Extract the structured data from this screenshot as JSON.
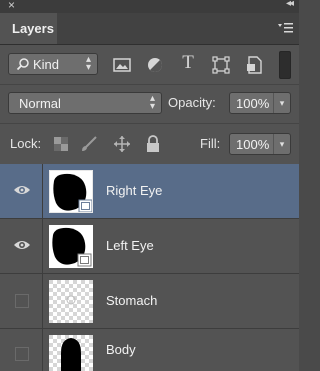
{
  "panel": {
    "close_glyph": "×",
    "collapse_glyph": "◂◂",
    "tab_label": "Layers"
  },
  "filter": {
    "kind_label": "Kind",
    "icons": [
      "pixel-filter-icon",
      "adjustment-filter-icon",
      "type-filter-icon",
      "shape-filter-icon",
      "smart-object-filter-icon"
    ],
    "type_glyph": "T"
  },
  "blend": {
    "mode": "Normal",
    "opacity_label": "Opacity:",
    "opacity_value": "100%"
  },
  "lock": {
    "label": "Lock:",
    "fill_label": "Fill:",
    "fill_value": "100%"
  },
  "layers": [
    {
      "name": "Right Eye",
      "visible": true,
      "selected": true
    },
    {
      "name": "Left Eye",
      "visible": true,
      "selected": false
    },
    {
      "name": "Stomach",
      "visible": false,
      "selected": false
    },
    {
      "name": "Body",
      "visible": false,
      "selected": false
    }
  ],
  "colors": {
    "panel_bg": "#535353",
    "selected_row": "#586c89",
    "field_bg": "#6e6e6e"
  }
}
